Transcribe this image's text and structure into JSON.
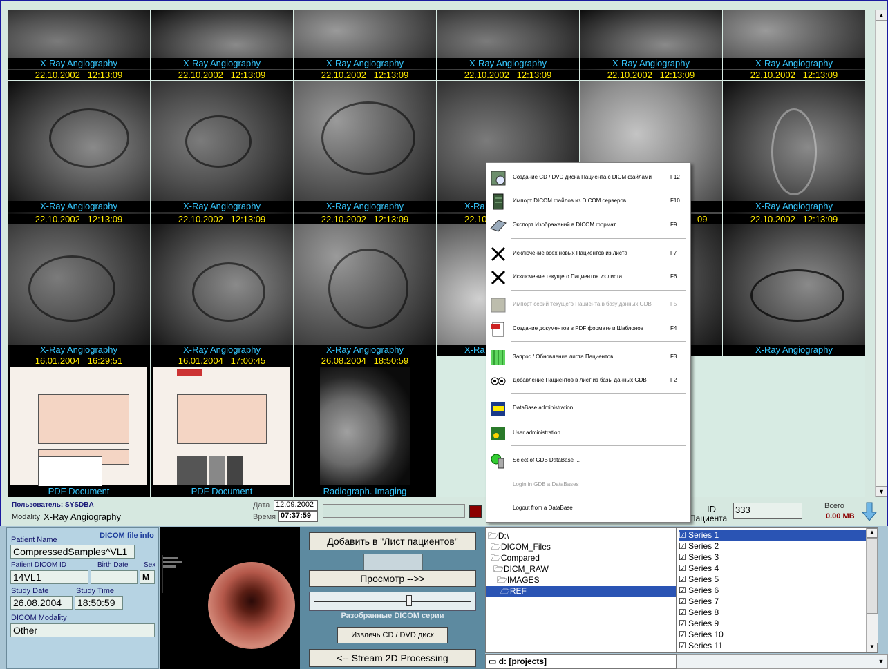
{
  "tiles": [
    {
      "modality": "X-Ray Angiography",
      "date": "22.10.2002",
      "time": "12:13:09"
    },
    {
      "modality": "X-Ray Angiography",
      "date": "22.10.2002",
      "time": "12:13:09"
    },
    {
      "modality": "X-Ray Angiography",
      "date": "22.10.2002",
      "time": "12:13:09"
    },
    {
      "modality": "X-Ray Angiography",
      "date": "22.10.2002",
      "time": "12:13:09"
    },
    {
      "modality": "X-Ray Angiography",
      "date": "22.10.2002",
      "time": "12:13:09"
    },
    {
      "modality": "X-Ray Angiography",
      "date": "22.10.2002",
      "time": "12:13:09"
    },
    {
      "modality": "X-Ray Angiography",
      "date": "22.10.2002",
      "time": "12:13:09"
    },
    {
      "modality": "X-Ray Angiography",
      "date": "22.10.2002",
      "time": "12:13:09"
    },
    {
      "modality": "X-Ray Angiography",
      "date": "22.10.2002",
      "time": "12:13:09"
    },
    {
      "modality": "X-Ra",
      "date": "22.10",
      "time": ""
    },
    {
      "modality": "",
      "date": "",
      "time": "09"
    },
    {
      "modality": "X-Ray Angiography",
      "date": "22.10.2002",
      "time": "12:13:09"
    },
    {
      "modality": "X-Ray Angiography",
      "date": "16.01.2004",
      "time": "16:29:51"
    },
    {
      "modality": "X-Ray Angiography",
      "date": "16.01.2004",
      "time": "17:00:45"
    },
    {
      "modality": "X-Ray Angiography",
      "date": "26.08.2004",
      "time": "18:50:59"
    },
    {
      "modality": "X-Ra",
      "date": "",
      "time": ""
    },
    {
      "modality": "",
      "date": "",
      "time": ""
    },
    {
      "modality": "X-Ray Angiography",
      "date": "",
      "time": ""
    },
    {
      "modality": "PDF Document",
      "date": "",
      "time": ""
    },
    {
      "modality": "PDF Document",
      "date": "",
      "time": ""
    },
    {
      "modality": "Radiograph. Imaging",
      "date": "",
      "time": ""
    }
  ],
  "infobar": {
    "user_label": "Пользователь: SYSDBA",
    "modality_label": "Modality",
    "modality_value": "X-Ray Angiography",
    "date_label": "Дата",
    "date_value": "12.09.2002",
    "time_label": "Время",
    "time_value": "07:37:59",
    "id_label_1": "ID",
    "id_label_2": "Пациента",
    "id_value": "333",
    "total_label": "Всего",
    "total_value": "0.00 MB"
  },
  "patient": {
    "name_label": "Patient Name",
    "dicom_info_link": "DICOM file info",
    "name_value": "CompressedSamples^VL1",
    "id_label": "Patient DICOM ID",
    "birth_label": "Birth Date",
    "sex_label": "Sex",
    "id_value": "14VL1",
    "birth_value": "",
    "sex_value": "M",
    "study_date_label": "Study Date",
    "study_time_label": "Study Time",
    "study_date_value": "26.08.2004",
    "study_time_value": "18:50:59",
    "modality_label": "DICOM Modality",
    "modality_value": "Other"
  },
  "controls": {
    "add_button": "Добавить в \"Лист пациентов\"",
    "view_button": "Просмотр   -->>",
    "slider_label": "Разобранные DICOM серии",
    "slider_value": 0.6,
    "eject_button": "Извлечь CD / DVD диск",
    "stream_button": "<-- Stream 2D Processing"
  },
  "tree": {
    "items": [
      "D:\\",
      "DICOM_Files",
      "Compared",
      "DICM_RAW",
      "IMAGES",
      "REF"
    ],
    "drive": "d: [projects]"
  },
  "series": [
    "Series  1",
    "Series  2",
    "Series  3",
    "Series  4",
    "Series  5",
    "Series  6",
    "Series  7",
    "Series  8",
    "Series  9",
    "Series  10",
    "Series  11"
  ],
  "menu": {
    "items": [
      {
        "label": "Создание CD / DVD диска Пациента с DICM файлами",
        "shortcut": "F12",
        "icon": "cd-create-icon"
      },
      {
        "label": "Импорт DICOM файлов из DICOM серверов",
        "shortcut": "F10",
        "icon": "server-import-icon"
      },
      {
        "label": "Экспорт Изображений в DICOM формат",
        "shortcut": "F9",
        "icon": "scanner-export-icon"
      },
      {
        "label": "Исключение  всех новых Пациентов из листа",
        "shortcut": "F7",
        "icon": "cross-icon"
      },
      {
        "label": "Исключение текущего Пациентов из листа",
        "shortcut": "F6",
        "icon": "cross-icon"
      },
      {
        "label": "Импорт серий текущего Пациента в базу данных GDB",
        "shortcut": "F5",
        "icon": "series-import-icon"
      },
      {
        "label": "Создание документов в PDF формате и Шаблонов",
        "shortcut": "F4",
        "icon": "pdf-icon"
      },
      {
        "label": "Запрос / Обновление листа Пациентов",
        "shortcut": "F3",
        "icon": "refresh-bars-icon"
      },
      {
        "label": "Добавление Пациентов в лист из базы данных GDB",
        "shortcut": "F2",
        "icon": "eyes-icon"
      },
      {
        "label": "DataBase administration...",
        "shortcut": "",
        "icon": "sql-icon"
      },
      {
        "label": "User administration...",
        "shortcut": "",
        "icon": "user-admin-icon"
      },
      {
        "label": "Select of GDB DataBase ...",
        "shortcut": "",
        "icon": "database-select-icon"
      },
      {
        "label": "Login in GDB a DataBases",
        "shortcut": "",
        "icon": ""
      },
      {
        "label": "Logout from a DataBase",
        "shortcut": "",
        "icon": ""
      }
    ]
  }
}
